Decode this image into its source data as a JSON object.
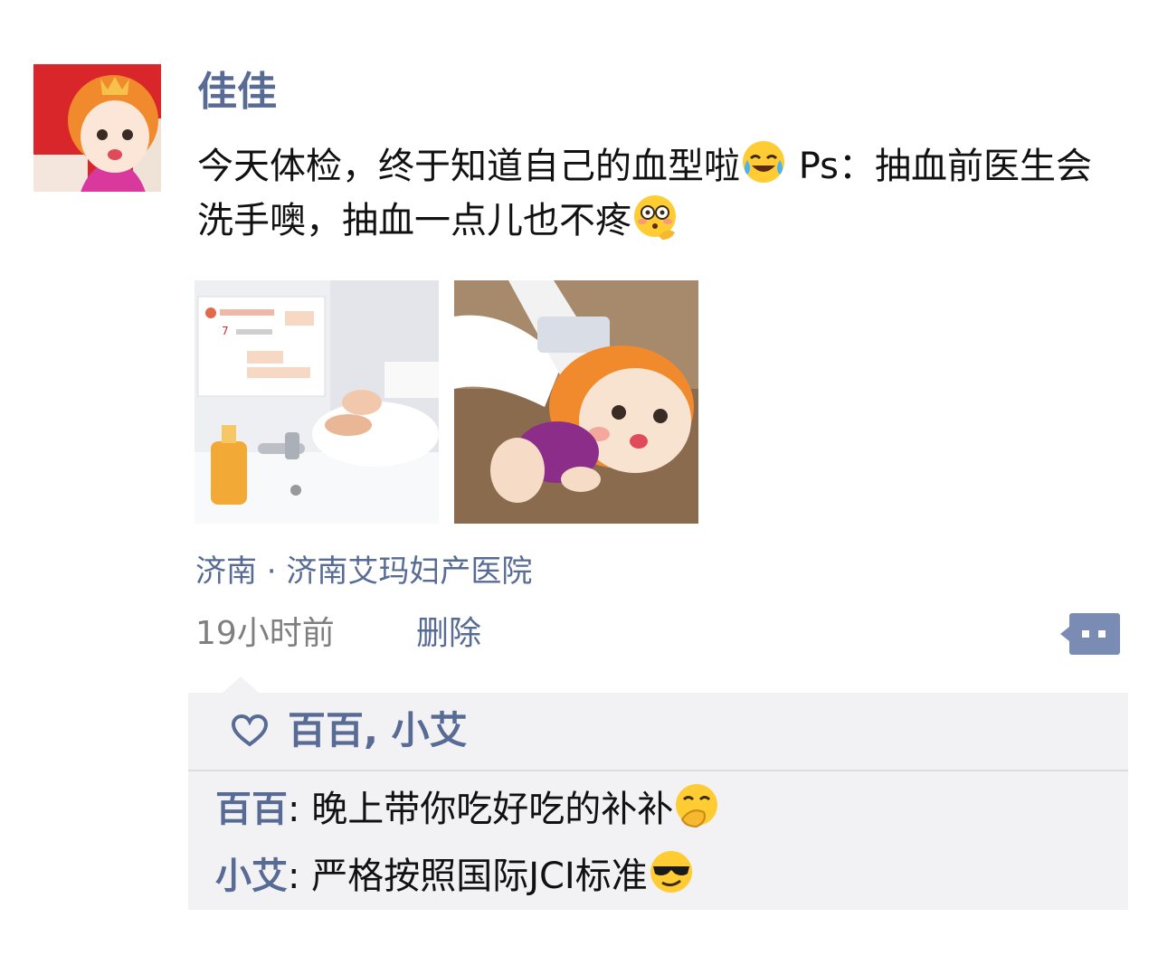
{
  "post": {
    "username": "佳佳",
    "text_part1": "今天体检，终于知道自己的血型啦",
    "emoji_laugh_cry": "laughing-crying-emoji",
    "text_part2": " Ps：抽血前医生会洗手噢，抽血一点儿也不疼",
    "emoji_dizzy": "flushed-face-emoji",
    "location": "济南 · 济南艾玛妇产医院",
    "time": "19小时前",
    "delete_label": "删除",
    "photos": [
      "photo-handwashing",
      "photo-blood-draw-doll"
    ]
  },
  "likes": {
    "icon": "heart-icon",
    "names": "百百, 小艾"
  },
  "comments": [
    {
      "author": "百百",
      "separator": ": ",
      "text": "晚上带你吃好吃的补补",
      "emoji": "hand-over-mouth-emoji"
    },
    {
      "author": "小艾",
      "separator": ": ",
      "text": "严格按照国际JCI标准",
      "emoji": "sunglasses-emoji"
    }
  ],
  "colors": {
    "link": "#576b95",
    "text": "#111111",
    "meta": "#7f7f7f",
    "comment_bg": "#f2f2f5",
    "avatar_bg": "#d8262a"
  }
}
